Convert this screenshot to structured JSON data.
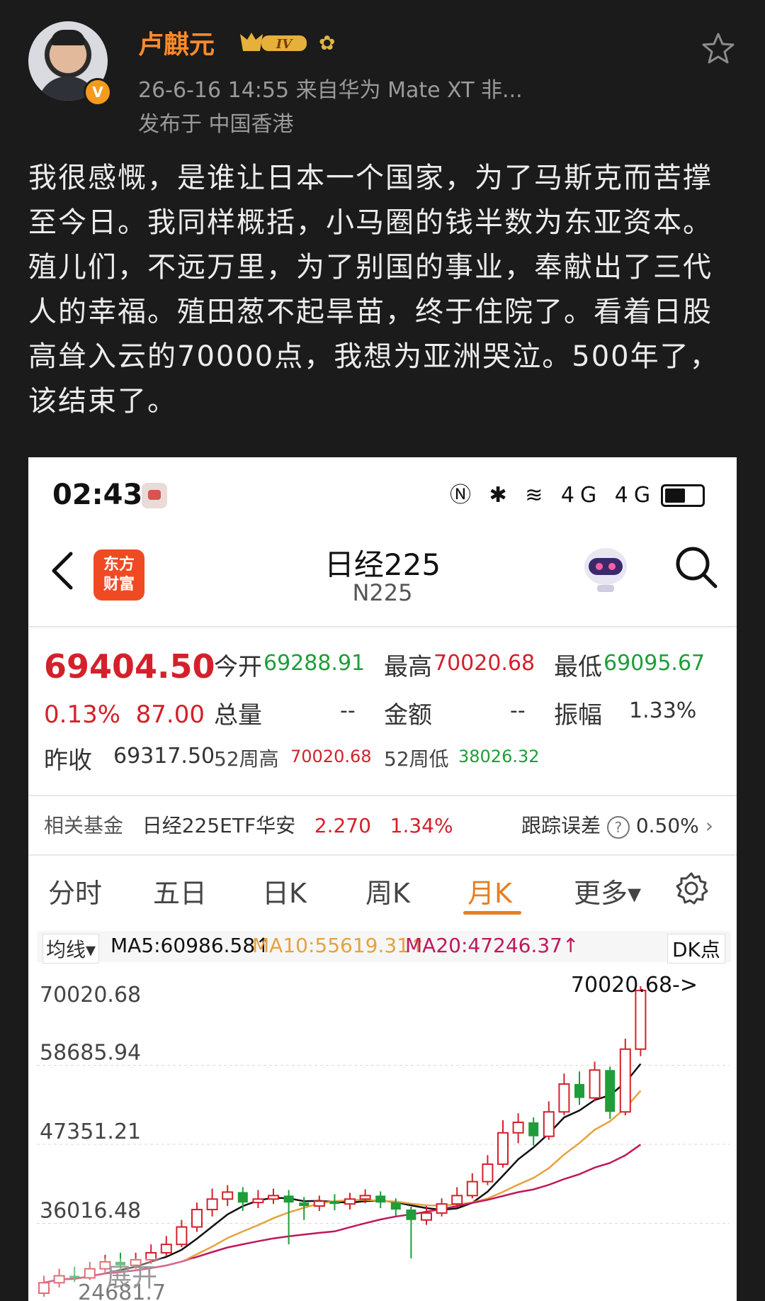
{
  "post": {
    "author": "卢麒元",
    "verified_badge": "V",
    "level": "IV",
    "meta": "26-6-16 14:55  来自华为 Mate XT 非...",
    "location": "发布于 中国香港",
    "text": "我很感慨，是谁让日本一个国家，为了马斯克而苦撑至今日。我同样概括，小马圈的钱半数为东亚资本。殖儿们，不远万里，为了别国的事业，奉献出了三代人的幸福。殖田葱不起旱苗，终于住院了。看着日股高耸入云的70000点，我想为亚洲哭泣。500年了，该结束了。"
  },
  "phone": {
    "time": "02:43",
    "status_icons": "Ⓝ ✱ ≋ 4G 4G",
    "app_logo_line1": "东方",
    "app_logo_line2": "财富",
    "stock_name": "日经225",
    "stock_code": "N225",
    "price": "69404.50",
    "change_pct": "0.13%",
    "change_abs": "87.00",
    "prev_close_label": "昨收",
    "prev_close": "69317.50",
    "open_label": "今开",
    "open": "69288.91",
    "high_label": "最高",
    "high": "70020.68",
    "low_label": "最低",
    "low": "69095.67",
    "volume_label": "总量",
    "volume": "--",
    "amount_label": "金额",
    "amount": "--",
    "amplitude_label": "振幅",
    "amplitude": "1.33%",
    "wk52_high_label": "52周高",
    "wk52_high": "70020.68",
    "wk52_low_label": "52周低",
    "wk52_low": "38026.32",
    "fund_label": "相关基金",
    "fund_name": "日经225ETF华安",
    "fund_price": "2.270",
    "fund_pct": "1.34%",
    "track_label": "跟踪误差",
    "track_value": "0.50%",
    "tabs": [
      "分时",
      "五日",
      "日K",
      "周K",
      "月K",
      "更多▾"
    ],
    "ma_selector": "均线▾",
    "ma5": "MA5:60986.58↑",
    "ma10": "MA10:55619.31↑",
    "ma20": "MA20:47246.37↑",
    "dk": "DK点",
    "expand": "展开",
    "colors": {
      "up": "#d3212b",
      "down": "#1f9d3a",
      "accent": "#e67e22"
    }
  },
  "chart_data": {
    "type": "candlestick",
    "y_ticks": [
      "70020.68",
      "58685.94",
      "47351.21",
      "36016.48"
    ],
    "high_annotation": "70020.68->",
    "bottom_partial": "24681.7",
    "ma_colors": {
      "MA5": "#111111",
      "MA10": "#e6a23c",
      "MA20": "#c0185b"
    }
  }
}
